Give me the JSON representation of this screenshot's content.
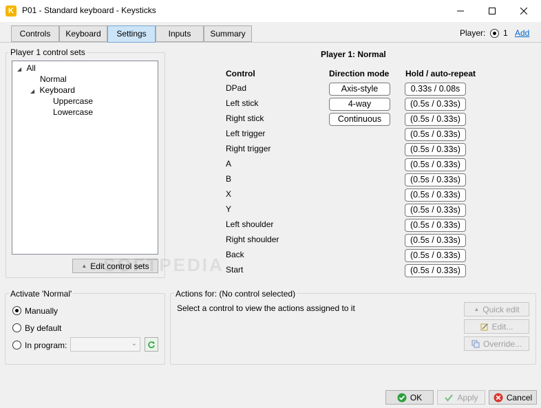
{
  "window": {
    "title": "P01 - Standard keyboard - Keysticks",
    "app_icon_letter": "K"
  },
  "tabs": [
    "Controls",
    "Keyboard",
    "Settings",
    "Inputs",
    "Summary"
  ],
  "active_tab": "Settings",
  "player": {
    "label": "Player:",
    "number": "1",
    "add_label": "Add"
  },
  "control_sets": {
    "group_title": "Player 1 control sets",
    "tree": [
      {
        "label": "All",
        "expanded": true
      },
      {
        "label": "Normal",
        "selected": true
      },
      {
        "label": "Keyboard",
        "expanded": true
      },
      {
        "label": "Uppercase"
      },
      {
        "label": "Lowercase"
      }
    ],
    "edit_button": "Edit control sets"
  },
  "panel": {
    "title": "Player 1: Normal",
    "headers": {
      "control": "Control",
      "direction": "Direction mode",
      "hold": "Hold / auto-repeat"
    },
    "rows": [
      {
        "control": "DPad",
        "direction": "Axis-style",
        "hold": "0.33s / 0.08s"
      },
      {
        "control": "Left stick",
        "direction": "4-way",
        "hold": "(0.5s / 0.33s)"
      },
      {
        "control": "Right stick",
        "direction": "Continuous",
        "hold": "(0.5s / 0.33s)"
      },
      {
        "control": "Left trigger",
        "hold": "(0.5s / 0.33s)"
      },
      {
        "control": "Right trigger",
        "hold": "(0.5s / 0.33s)"
      },
      {
        "control": "A",
        "hold": "(0.5s / 0.33s)"
      },
      {
        "control": "B",
        "hold": "(0.5s / 0.33s)"
      },
      {
        "control": "X",
        "hold": "(0.5s / 0.33s)"
      },
      {
        "control": "Y",
        "hold": "(0.5s / 0.33s)"
      },
      {
        "control": "Left shoulder",
        "hold": "(0.5s / 0.33s)"
      },
      {
        "control": "Right shoulder",
        "hold": "(0.5s / 0.33s)"
      },
      {
        "control": "Back",
        "hold": "(0.5s / 0.33s)"
      },
      {
        "control": "Start",
        "hold": "(0.5s / 0.33s)"
      }
    ]
  },
  "activate": {
    "group_title": "Activate 'Normal'",
    "manually": "Manually",
    "by_default": "By default",
    "in_program": "In program:",
    "selected": "manually"
  },
  "actions": {
    "group_title": "Actions for: (No control selected)",
    "message": "Select a control to view the actions assigned to it",
    "quick_edit": "Quick edit",
    "edit": "Edit...",
    "override": "Override..."
  },
  "footer": {
    "ok": "OK",
    "apply": "Apply",
    "cancel": "Cancel"
  },
  "watermark": "SOFTPEDIA",
  "colors": {
    "accent": "#0066cc",
    "tab_active": "#cce4f7",
    "ok_green": "#2e9e3e",
    "cancel_red": "#d9342b"
  }
}
